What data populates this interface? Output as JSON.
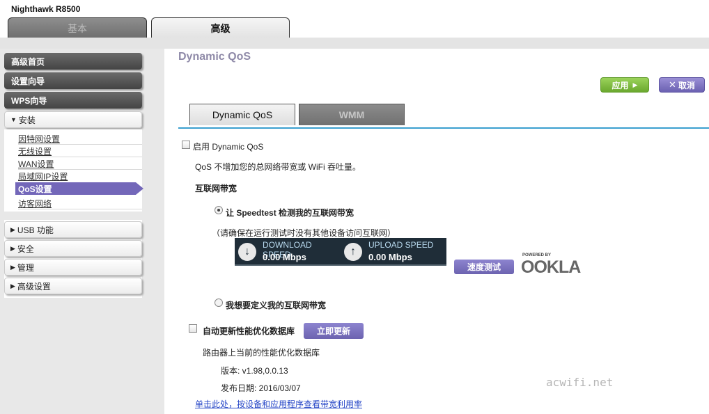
{
  "app": {
    "model": "Nighthawk R8500"
  },
  "top_tabs": [
    {
      "label": "基本"
    },
    {
      "label": "高级"
    }
  ],
  "sidebar": {
    "main_items": [
      {
        "label": "高级首页"
      },
      {
        "label": "设置向导"
      },
      {
        "label": "WPS向导"
      }
    ],
    "install": {
      "label": "安装"
    },
    "sub_items": [
      {
        "label": "因特网设置"
      },
      {
        "label": "无线设置"
      },
      {
        "label": "WAN设置"
      },
      {
        "label": "局域网IP设置"
      },
      {
        "label": "QoS设置"
      },
      {
        "label": "访客网络"
      }
    ],
    "collapsed": [
      {
        "label": "USB 功能"
      },
      {
        "label": "安全"
      },
      {
        "label": "管理"
      },
      {
        "label": "高级设置"
      }
    ]
  },
  "main": {
    "title": "Dynamic QoS",
    "apply_label": "应用",
    "cancel_label": "取消",
    "tabs": [
      {
        "label": "Dynamic QoS"
      },
      {
        "label": "WMM"
      }
    ],
    "enable_label": "启用 Dynamic QoS",
    "description": "QoS 不增加您的总网络带宽或 WiFi 吞吐量。",
    "bandwidth_heading": "互联网带宽",
    "radio_speedtest": "让 Speedtest 检测我的互联网带宽",
    "speedtest_note": "（请确保在运行测试时没有其他设备访问互联网）",
    "download": {
      "label": "DOWNLOAD SPEED",
      "value": "0.00 Mbps"
    },
    "upload": {
      "label": "UPLOAD SPEED",
      "value": "0.00 Mbps"
    },
    "speedtest_button": "速度测试",
    "ookla_powered": "POWERED BY",
    "ookla_brand": "OOKLA",
    "radio_custom": "我想要定义我的互联网带宽",
    "auto_update_label": "自动更新性能优化数据库",
    "update_now_button": "立即更新",
    "db_label": "路由器上当前的性能优化数据库",
    "version": "版本: v1.98,0.0.13",
    "release_date": "发布日期: 2016/03/07",
    "usage_link": "单击此处，按设备和应用程序查看带宽利用率"
  },
  "watermark": "acwifi.net",
  "colors": {
    "accent": "#7367b9",
    "apply_green": "#7fbf44",
    "tab_line": "#3a9fcf"
  }
}
